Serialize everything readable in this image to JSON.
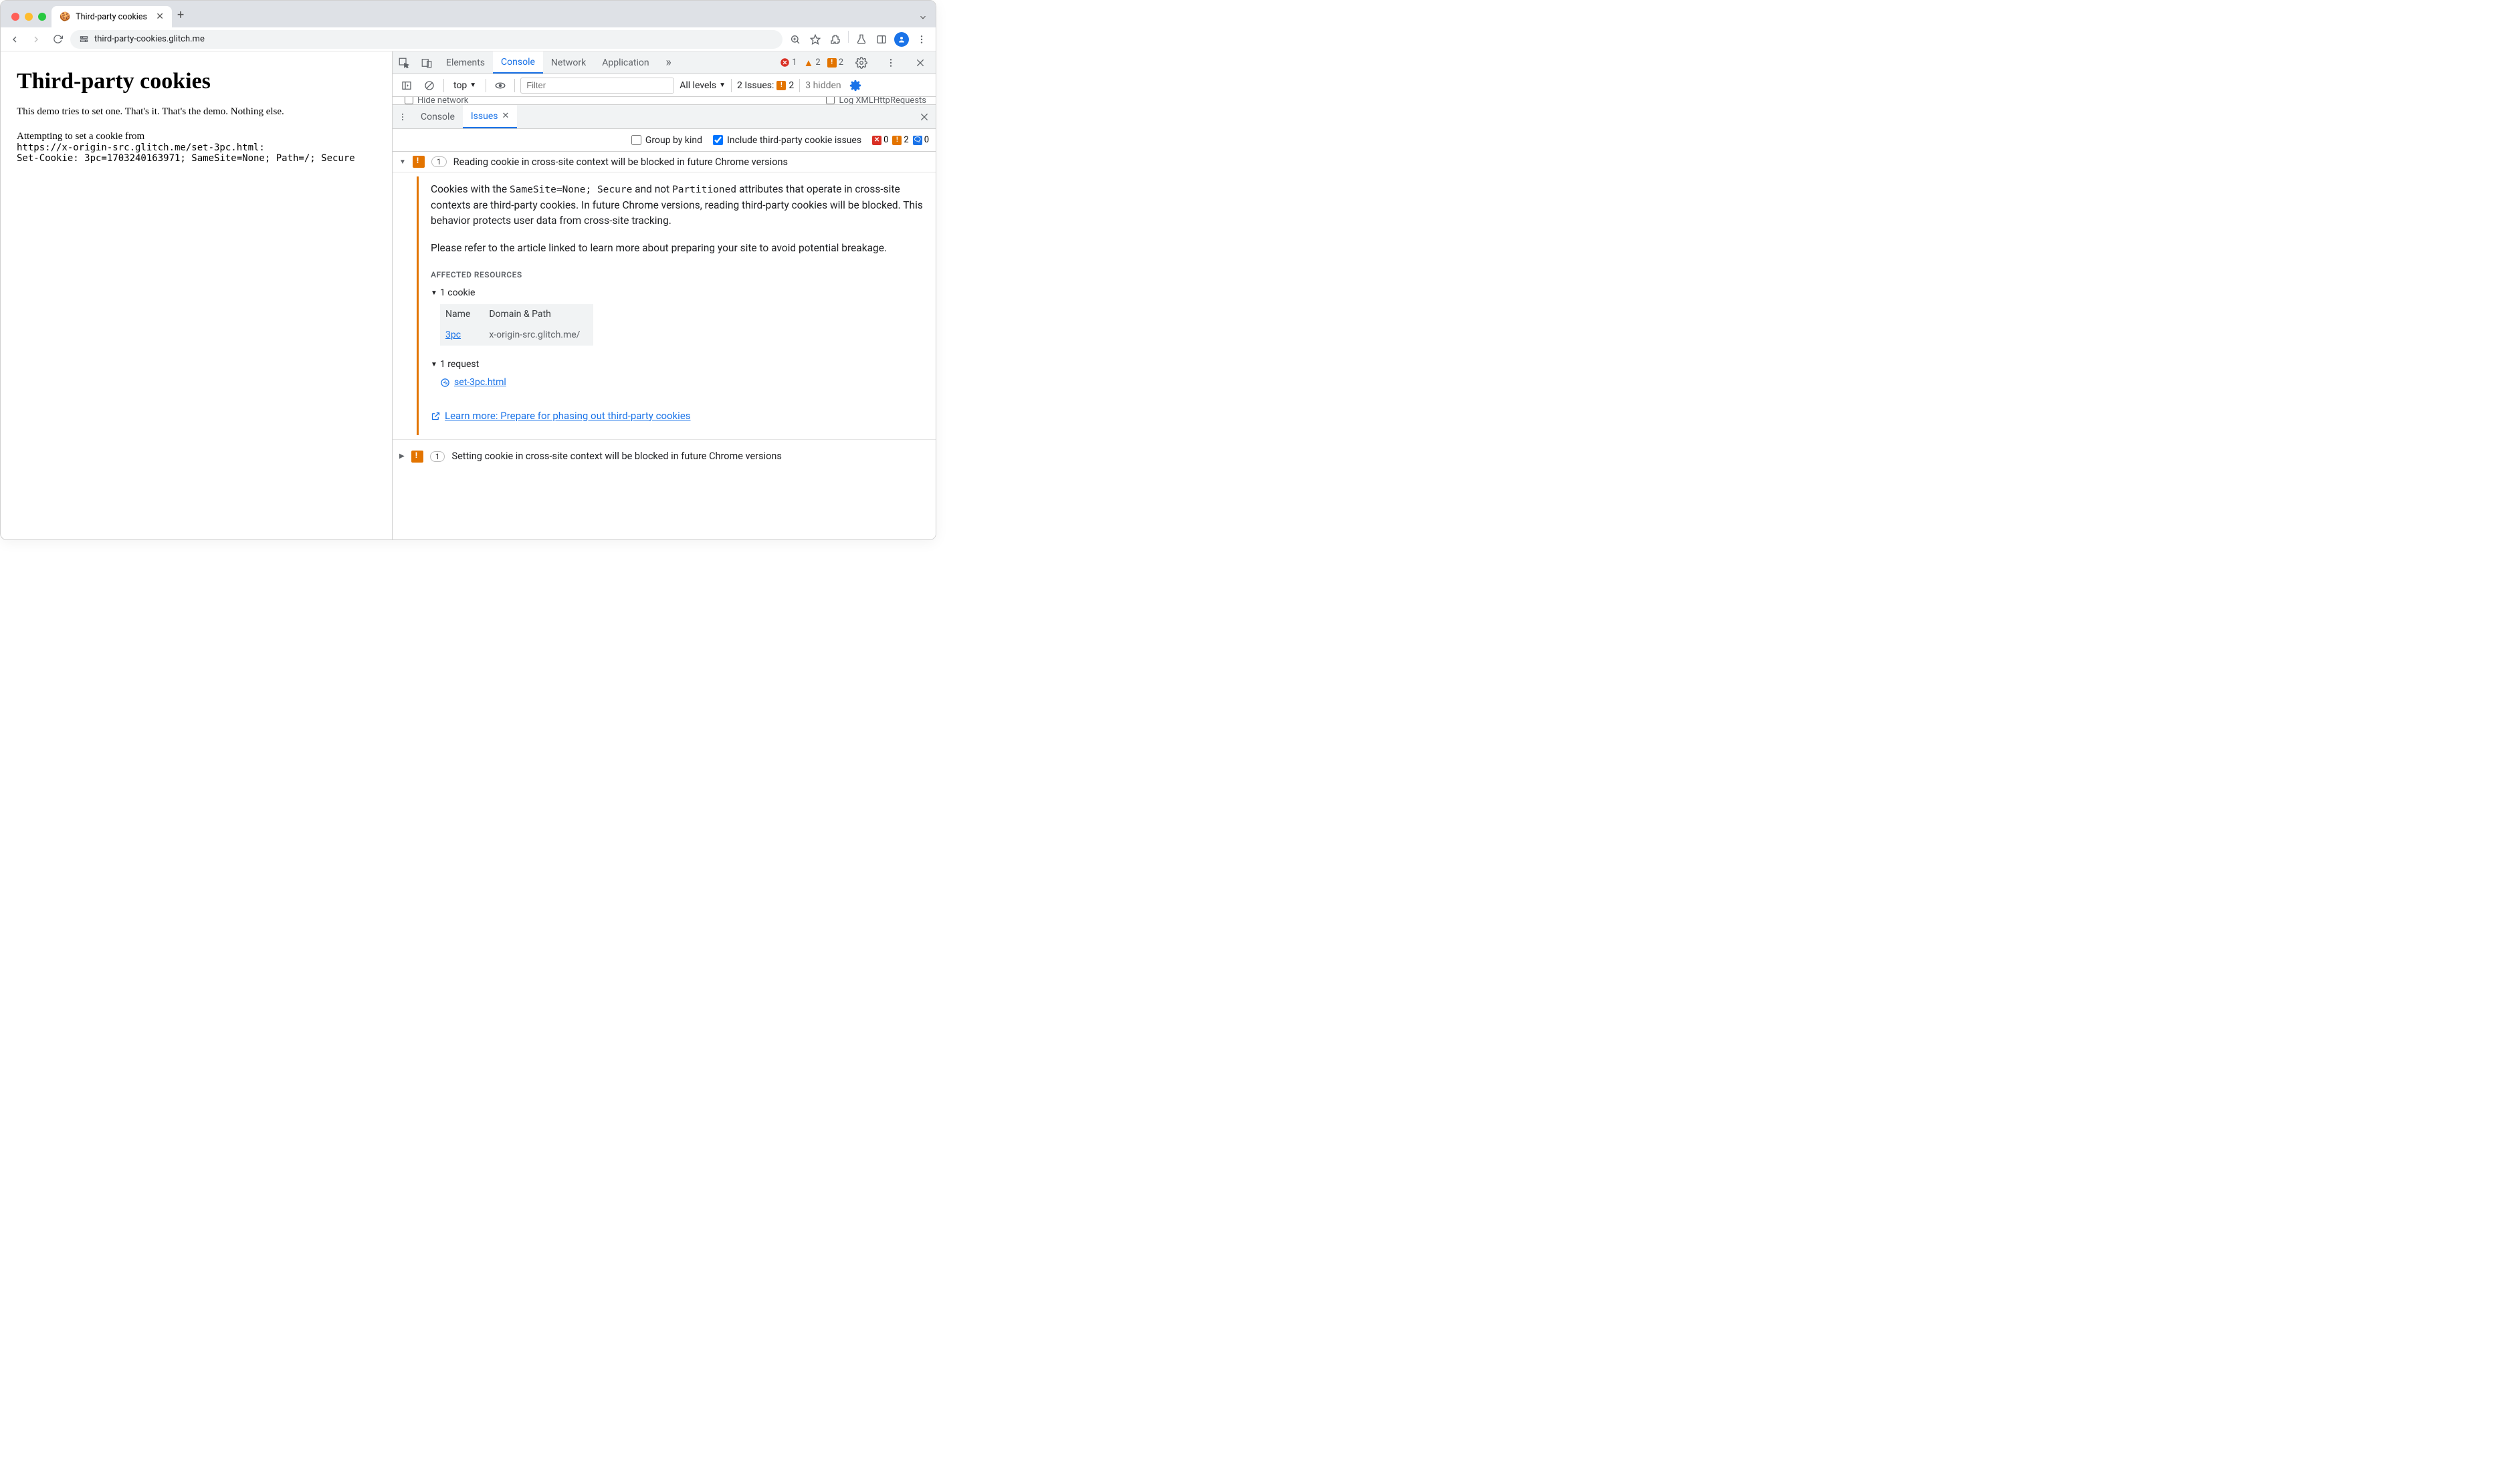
{
  "browser": {
    "tab_title": "Third-party cookies",
    "url": "third-party-cookies.glitch.me"
  },
  "page": {
    "heading": "Third-party cookies",
    "intro": "This demo tries to set one. That's it. That's the demo. Nothing else.",
    "attempt_line": "Attempting to set a cookie from",
    "origin": "https://x-origin-src.glitch.me/set-3pc.html:",
    "set_cookie": "Set-Cookie: 3pc=1703240163971; SameSite=None; Path=/; Secure"
  },
  "devtools": {
    "tabs": [
      "Elements",
      "Console",
      "Network",
      "Application"
    ],
    "active_tab": "Console",
    "status": {
      "errors": "1",
      "warnings": "2",
      "issues": "2"
    },
    "console_bar": {
      "context": "top",
      "filter_placeholder": "Filter",
      "levels": "All levels",
      "issues_label": "2 Issues:",
      "issues_count": "2",
      "hidden": "3 hidden"
    },
    "cut_row": {
      "left": "Hide network",
      "right": "Log XMLHttpRequests"
    },
    "drawer": {
      "tabs": [
        "Console",
        "Issues"
      ],
      "active_tab": "Issues"
    },
    "issues_bar": {
      "group_label": "Group by kind",
      "include_label": "Include third-party cookie issues",
      "counts": {
        "err": "0",
        "warn": "2",
        "info": "0"
      }
    },
    "issues": [
      {
        "count": "1",
        "title": "Reading cookie in cross-site context will be blocked in future Chrome versions",
        "expanded": true,
        "body": {
          "para1_a": "Cookies with the ",
          "para1_code1": "SameSite=None; Secure",
          "para1_b": " and not ",
          "para1_code2": "Partitioned",
          "para1_c": " attributes that operate in cross-site contexts are third-party cookies. In future Chrome versions, reading third-party cookies will be blocked. This behavior protects user data from cross-site tracking.",
          "para2": "Please refer to the article linked to learn more about preparing your site to avoid potential breakage.",
          "affected_heading": "Affected Resources",
          "cookie_sub": "1 cookie",
          "table": {
            "headers": [
              "Name",
              "Domain & Path"
            ],
            "rows": [
              [
                "3pc",
                "x-origin-src.glitch.me/"
              ]
            ]
          },
          "request_sub": "1 request",
          "request_link": "set-3pc.html",
          "learn_more": "Learn more: Prepare for phasing out third-party cookies"
        }
      },
      {
        "count": "1",
        "title": "Setting cookie in cross-site context will be blocked in future Chrome versions",
        "expanded": false
      }
    ]
  }
}
